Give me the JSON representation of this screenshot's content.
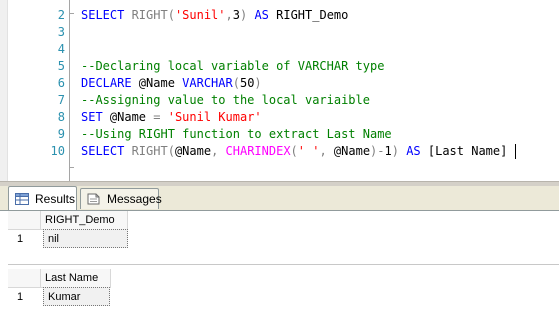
{
  "editor": {
    "line_numbers": [
      "2",
      "3",
      "4",
      "5",
      "6",
      "7",
      "8",
      "9",
      "10"
    ],
    "lines": [
      [
        {
          "t": "SELECT ",
          "c": "kw"
        },
        {
          "t": "RIGHT",
          "c": "op"
        },
        {
          "t": "(",
          "c": "op"
        },
        {
          "t": "'Sunil'",
          "c": "str"
        },
        {
          "t": ",",
          "c": "op"
        },
        {
          "t": "3",
          "c": "txt"
        },
        {
          "t": ") ",
          "c": "op"
        },
        {
          "t": "AS",
          "c": "kw"
        },
        {
          "t": " RIGHT_Demo",
          "c": "txt"
        }
      ],
      [],
      [],
      [
        {
          "t": "--Declaring local variable of VARCHAR type",
          "c": "cmt"
        }
      ],
      [
        {
          "t": "DECLARE ",
          "c": "kw"
        },
        {
          "t": "@Name ",
          "c": "txt"
        },
        {
          "t": "VARCHAR",
          "c": "kw"
        },
        {
          "t": "(",
          "c": "op"
        },
        {
          "t": "50",
          "c": "txt"
        },
        {
          "t": ")",
          "c": "op"
        }
      ],
      [
        {
          "t": "--Assigning value to the local variaible",
          "c": "cmt"
        }
      ],
      [
        {
          "t": "SET ",
          "c": "kw"
        },
        {
          "t": "@Name ",
          "c": "txt"
        },
        {
          "t": "= ",
          "c": "op"
        },
        {
          "t": "'Sunil Kumar'",
          "c": "str"
        }
      ],
      [
        {
          "t": "--Using RIGHT function to extract Last Name",
          "c": "cmt"
        }
      ],
      [
        {
          "t": "SELECT ",
          "c": "kw"
        },
        {
          "t": "RIGHT",
          "c": "op"
        },
        {
          "t": "(",
          "c": "op"
        },
        {
          "t": "@Name",
          "c": "txt"
        },
        {
          "t": ", ",
          "c": "op"
        },
        {
          "t": "CHARINDEX",
          "c": "fn"
        },
        {
          "t": "(",
          "c": "op"
        },
        {
          "t": "' '",
          "c": "str"
        },
        {
          "t": ", ",
          "c": "op"
        },
        {
          "t": "@Name",
          "c": "txt"
        },
        {
          "t": ")",
          "c": "op"
        },
        {
          "t": "-",
          "c": "op"
        },
        {
          "t": "1",
          "c": "txt"
        },
        {
          "t": ") ",
          "c": "op"
        },
        {
          "t": "AS",
          "c": "kw"
        },
        {
          "t": " [Last Name]",
          "c": "txt"
        }
      ]
    ]
  },
  "tabs": {
    "results_label": "Results",
    "messages_label": "Messages"
  },
  "results": {
    "grid1": {
      "header": "RIGHT_Demo",
      "row_num": "1",
      "value": "nil"
    },
    "grid2": {
      "header": "Last Name",
      "row_num": "1",
      "value": "Kumar"
    }
  }
}
